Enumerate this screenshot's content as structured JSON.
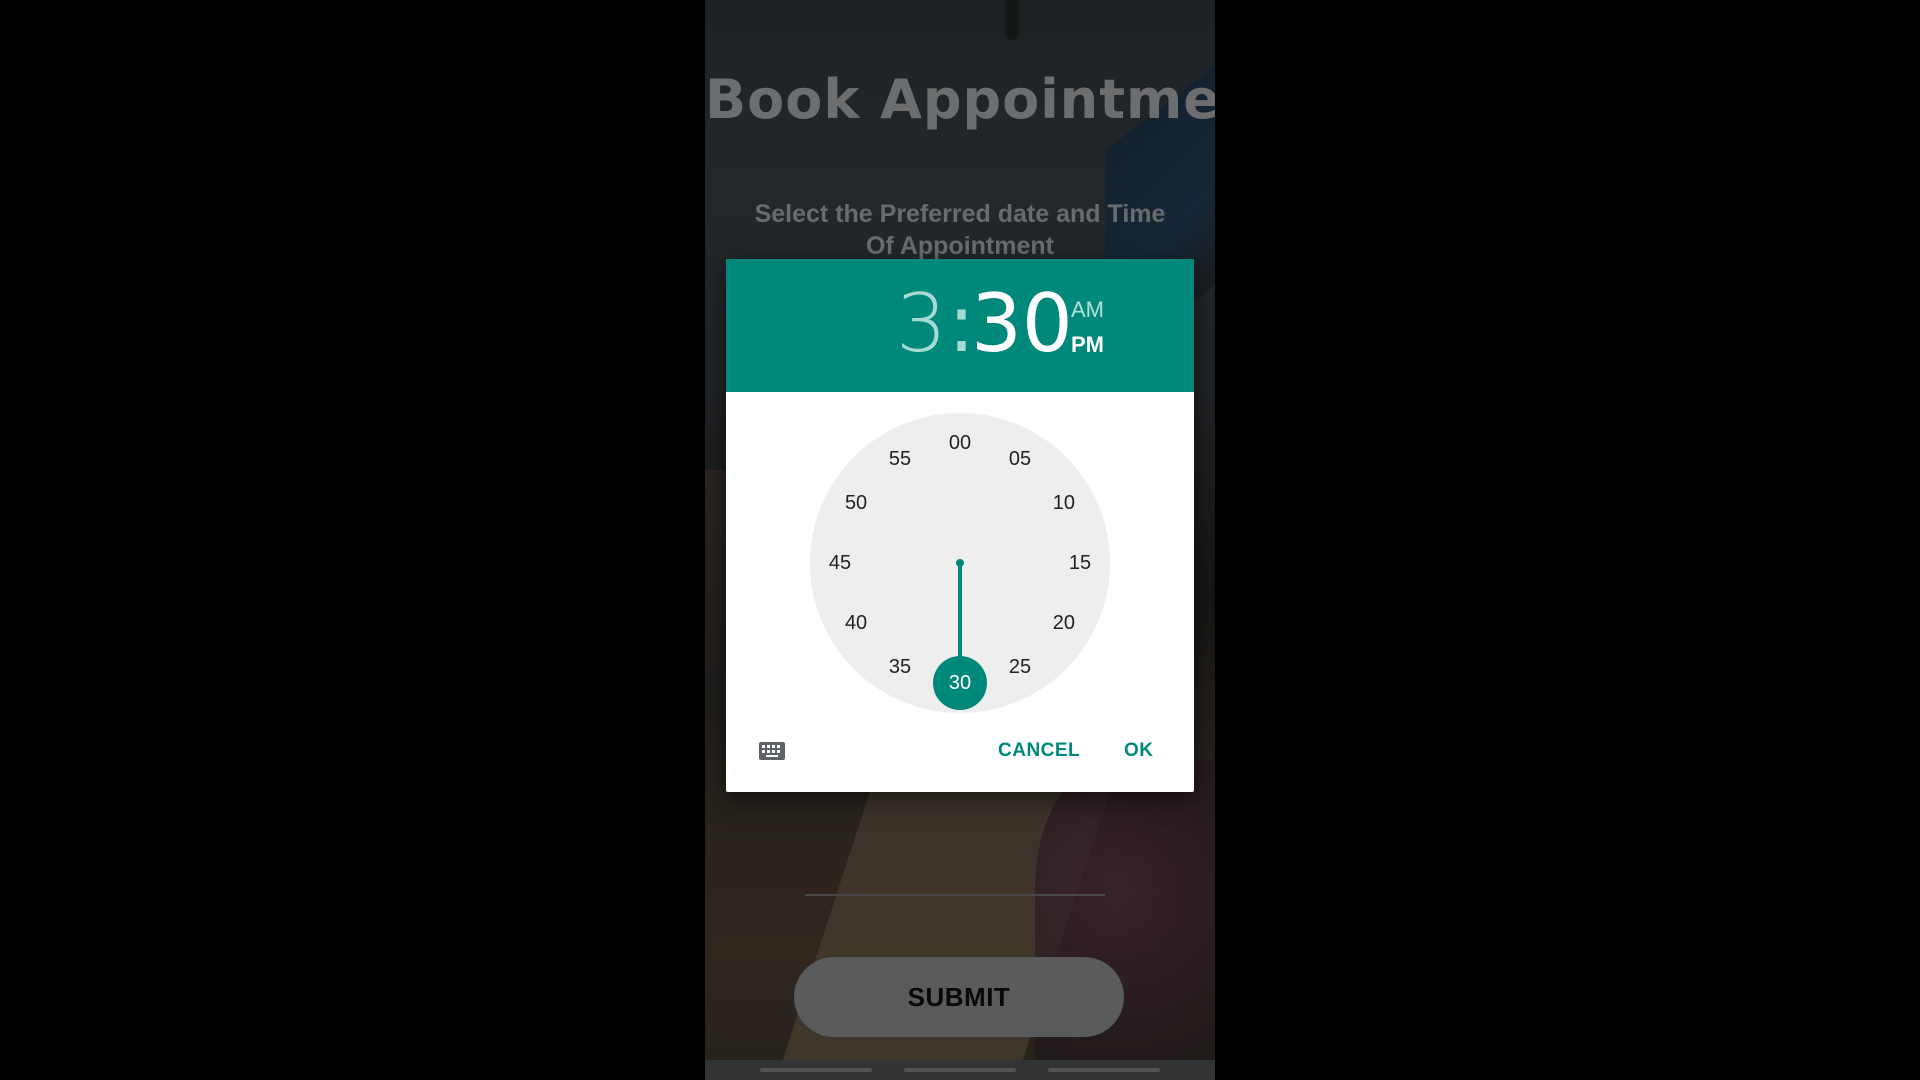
{
  "screen": {
    "title": "Book Appointment",
    "subtitle": "Select the Preferred date and Time Of Appointment",
    "submit_label": "SUBMIT"
  },
  "time_picker": {
    "hour": "3",
    "separator": ":",
    "minute": "30",
    "am_label": "AM",
    "pm_label": "PM",
    "selected_period": "PM",
    "selected_minute": "30",
    "minute_labels": [
      "00",
      "05",
      "10",
      "15",
      "20",
      "25",
      "30",
      "35",
      "40",
      "45",
      "50",
      "55"
    ],
    "cancel_label": "CANCEL",
    "ok_label": "OK",
    "input_mode_icon": "keyboard-icon"
  },
  "colors": {
    "accent": "#00897b",
    "header_background": "#00897b",
    "clock_face": "#eeeeee"
  }
}
